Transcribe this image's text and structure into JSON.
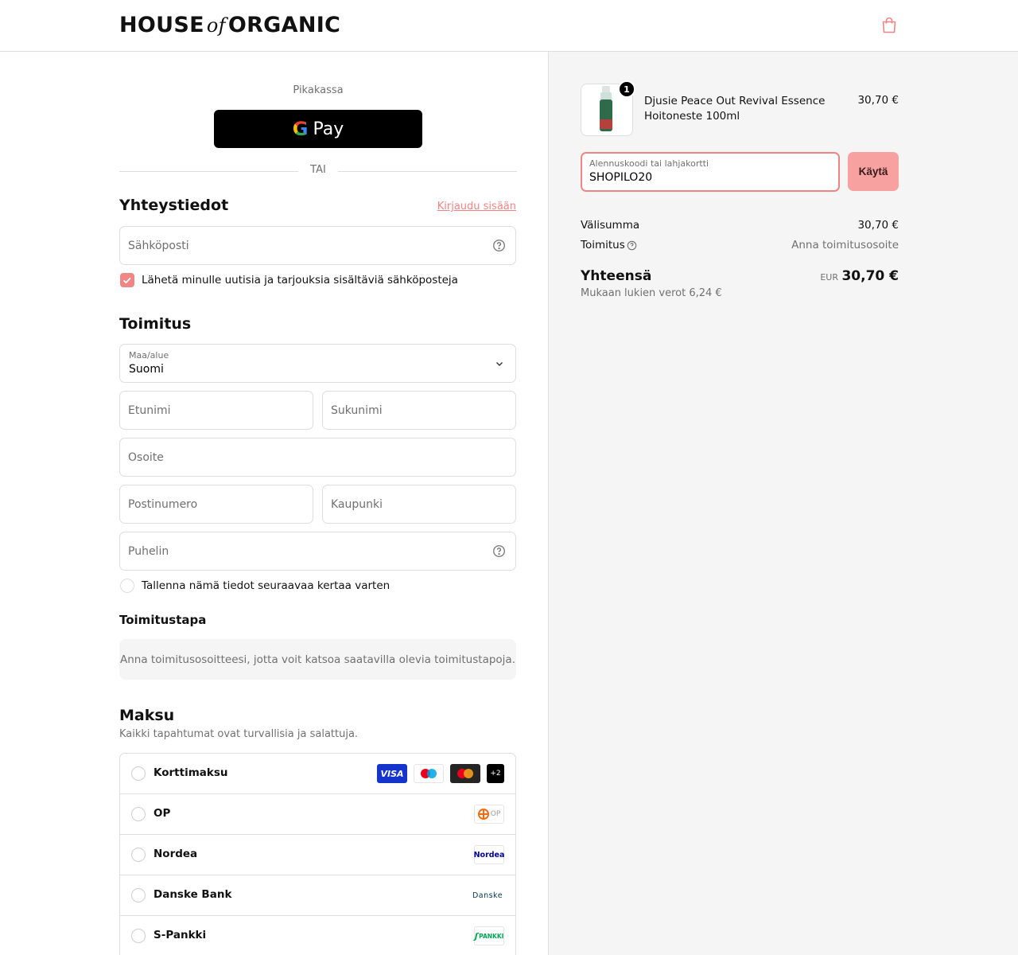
{
  "header": {
    "logo_left": "HOUSE",
    "logo_of": "of",
    "logo_right": "ORGANIC"
  },
  "express": {
    "label": "Pikakassa",
    "gpay_label": "Pay",
    "gpay_letter": "G",
    "divider": "TAI"
  },
  "contact": {
    "title": "Yhteystiedot",
    "login_link": "Kirjaudu sisään",
    "email_placeholder": "Sähköposti",
    "newsletter_label": "Lähetä minulle uutisia ja tarjouksia sisältäviä sähköposteja",
    "newsletter_checked": true
  },
  "delivery": {
    "title": "Toimitus",
    "country_label": "Maa/alue",
    "country_value": "Suomi",
    "first_name_placeholder": "Etunimi",
    "last_name_placeholder": "Sukunimi",
    "address_placeholder": "Osoite",
    "postal_placeholder": "Postinumero",
    "city_placeholder": "Kaupunki",
    "phone_placeholder": "Puhelin",
    "save_label": "Tallenna nämä tiedot seuraavaa kertaa varten",
    "save_checked": false
  },
  "shipping_method": {
    "title": "Toimitustapa",
    "note": "Anna toimitusosoitteesi, jotta voit katsoa saatavilla olevia toimitustapoja."
  },
  "payment": {
    "title": "Maksu",
    "subtitle": "Kaikki tapahtumat ovat turvallisia ja salattuja.",
    "options": [
      {
        "name": "Korttimaksu",
        "logos": [
          "VISA",
          "maestro",
          "mastercard",
          "+2"
        ]
      },
      {
        "name": "OP",
        "logos": [
          "OP"
        ]
      },
      {
        "name": "Nordea",
        "logos": [
          "Nordea"
        ]
      },
      {
        "name": "Danske Bank",
        "logos": [
          "Danske"
        ]
      },
      {
        "name": "S-Pankki",
        "logos": [
          "PANKKI"
        ]
      }
    ]
  },
  "summary": {
    "item": {
      "name": "Djusie Peace Out Revival Essence Hoitoneste 100ml",
      "quantity": "1",
      "price": "30,70 €"
    },
    "discount_label": "Alennuskoodi tai lahjakortti",
    "discount_value": "SHOPILO20",
    "apply_label": "Käytä",
    "subtotal_label": "Välisumma",
    "subtotal_value": "30,70 €",
    "shipping_label": "Toimitus",
    "shipping_value": "Anna toimitusosoite",
    "total_label": "Yhteensä",
    "total_currency": "EUR",
    "total_value": "30,70 €",
    "tax_note": "Mukaan lukien verot 6,24 €"
  },
  "colors": {
    "accent": "#f08585",
    "apply_button": "#f7a1a1",
    "summary_bg": "#f5f5f5",
    "border": "#dedede"
  }
}
